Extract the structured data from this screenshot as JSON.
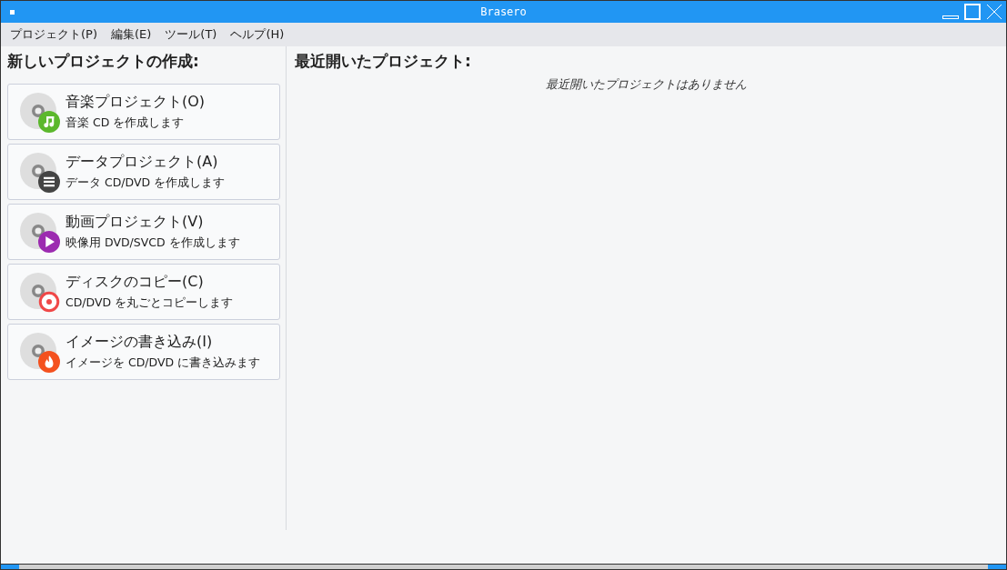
{
  "window": {
    "title": "Brasero"
  },
  "menu": [
    "プロジェクト(P)",
    "編集(E)",
    "ツール(T)",
    "ヘルプ(H)"
  ],
  "new_project": {
    "heading": "新しいプロジェクトの作成:",
    "items": [
      {
        "title": "音楽プロジェクト(O)",
        "subtitle": "音楽 CD を作成します",
        "kind": "music",
        "color": "#5cb82d"
      },
      {
        "title": "データプロジェクト(A)",
        "subtitle": "データ CD/DVD を作成します",
        "kind": "data",
        "color": "#444444"
      },
      {
        "title": "動画プロジェクト(V)",
        "subtitle": "映像用 DVD/SVCD を作成します",
        "kind": "video",
        "color": "#9c2bb0"
      },
      {
        "title": "ディスクのコピー(C)",
        "subtitle": "CD/DVD を丸ごとコピーします",
        "kind": "copy",
        "color": "#f04848"
      },
      {
        "title": "イメージの書き込み(I)",
        "subtitle": "イメージを CD/DVD に書き込みます",
        "kind": "burn",
        "color": "#f4511e"
      }
    ]
  },
  "recent": {
    "heading": "最近開いたプロジェクト:",
    "empty_message": "最近開いたプロジェクトはありません"
  }
}
